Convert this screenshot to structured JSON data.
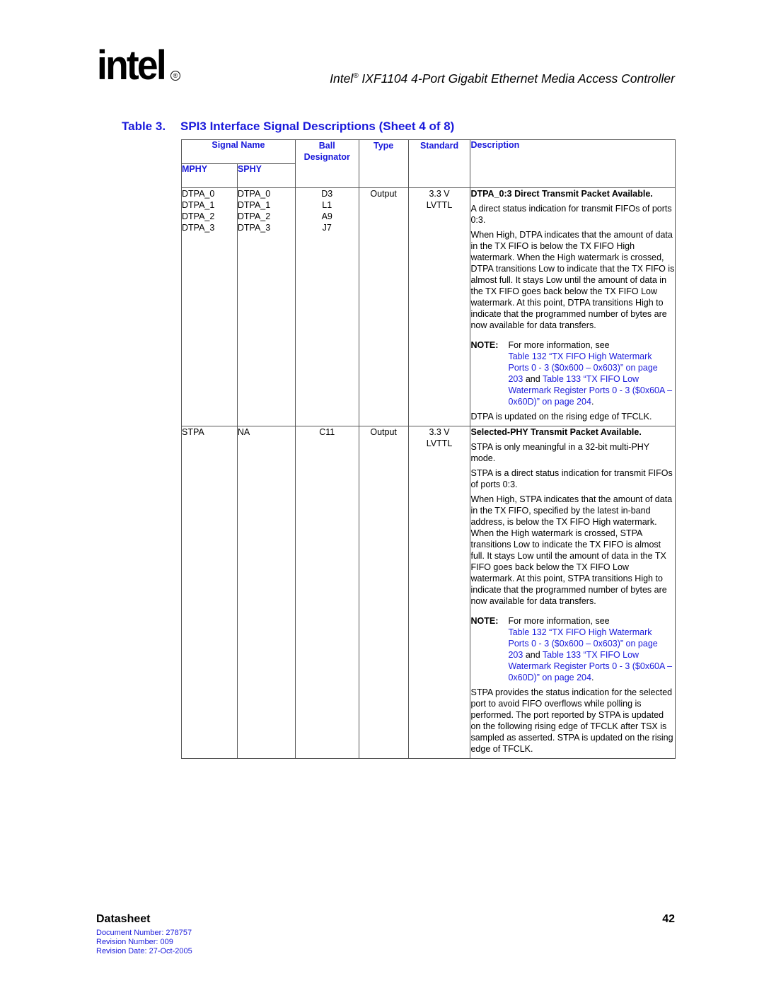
{
  "header": {
    "logo_text": "intel",
    "logo_reg": "®",
    "title_prefix": "Intel",
    "title_reg": "®",
    "title_rest": " IXF1104 4-Port Gigabit Ethernet Media Access Controller"
  },
  "caption": {
    "number": "Table 3.",
    "title": "SPI3 Interface Signal Descriptions (Sheet 4 of 8)"
  },
  "table": {
    "headers": {
      "signal_name": "Signal Name",
      "mphy": "MPHY",
      "sphy": "SPHY",
      "ball_line1": "Ball",
      "ball_line2": "Designator",
      "type": "Type",
      "standard": "Standard",
      "description": "Description"
    },
    "rows": [
      {
        "mphy": [
          "DTPA_0",
          "DTPA_1",
          "DTPA_2",
          "DTPA_3"
        ],
        "sphy": [
          "DTPA_0",
          "DTPA_1",
          "DTPA_2",
          "DTPA_3"
        ],
        "ball": [
          "D3",
          "L1",
          "A9",
          "J7"
        ],
        "type": "Output",
        "standard_line1": "3.3 V",
        "standard_line2": "LVTTL",
        "desc_heading": "DTPA_0:3 Direct Transmit Packet Available.",
        "desc_paras_before": [
          "A direct status indication for transmit FIFOs of ports 0:3.",
          "When High, DTPA indicates that the amount of data in the TX FIFO is below the TX FIFO High watermark. When the High watermark is crossed, DTPA transitions Low to indicate that the TX FIFO is almost full. It stays Low until the amount of data in the TX FIFO goes back below the TX FIFO Low watermark. At this point, DTPA transitions High to indicate that the programmed number of bytes are now available for data transfers."
        ],
        "note_label": "NOTE:",
        "note_intro": "For more information, see",
        "note_link1": "Table 132 “TX FIFO High Watermark Ports 0 - 3 ($0x600 – 0x603)” on page 203",
        "note_and": " and ",
        "note_link2": "Table 133 “TX FIFO Low Watermark Register Ports 0 - 3 ($0x60A – 0x60D)” on page 204",
        "note_end": ".",
        "desc_paras_after": [
          "DTPA is updated on the rising edge of TFCLK."
        ]
      },
      {
        "mphy": [
          "STPA"
        ],
        "sphy": [
          "NA"
        ],
        "ball": [
          "C11"
        ],
        "type": "Output",
        "standard_line1": "3.3 V",
        "standard_line2": "LVTTL",
        "desc_heading": "Selected-PHY Transmit Packet Available.",
        "desc_paras_before": [
          "STPA is only meaningful in a 32-bit multi-PHY mode.",
          "STPA is a direct status indication for transmit FIFOs of ports 0:3.",
          "When High, STPA indicates that the amount of data in the TX FIFO, specified by the latest in-band address, is below the TX FIFO High watermark. When the High watermark is crossed, STPA transitions Low to indicate the TX FIFO is almost full. It stays Low until the amount of data in the TX FIFO goes back below the TX FIFO Low watermark. At this point, STPA transitions High to indicate that the programmed number of bytes are now available for data transfers."
        ],
        "note_label": "NOTE:",
        "note_intro": "For more information, see",
        "note_link1": "Table 132 “TX FIFO High Watermark Ports 0 - 3 ($0x600 – 0x603)” on page 203",
        "note_and": " and ",
        "note_link2": "Table 133 “TX FIFO Low Watermark Register Ports 0 - 3 ($0x60A – 0x60D)” on page 204",
        "note_end": ".",
        "desc_paras_after": [
          "STPA provides the status indication for the selected port to avoid FIFO overflows while polling is performed. The port reported by STPA is updated on the following rising edge of TFCLK after TSX is sampled as asserted. STPA is updated on the rising edge of TFCLK."
        ]
      }
    ]
  },
  "footer": {
    "title": "Datasheet",
    "page_number": "42",
    "document_number": "Document Number: 278757",
    "revision_number": "Revision Number: 009",
    "revision_date": "Revision Date: 27-Oct-2005"
  },
  "colors": {
    "accent_blue": "#1a1adb",
    "text": "#000000",
    "border": "#555555"
  }
}
